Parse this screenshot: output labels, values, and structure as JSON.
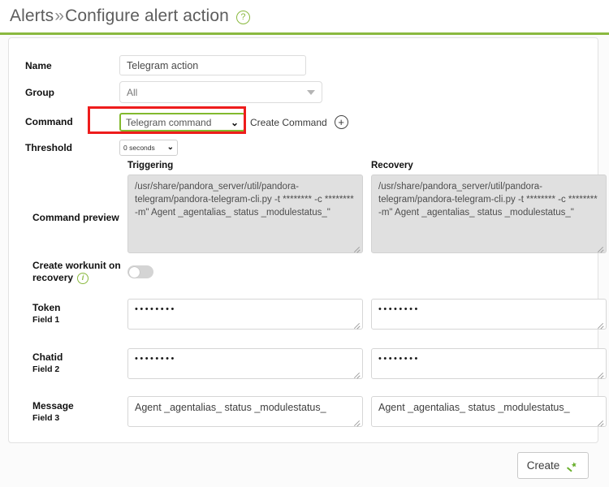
{
  "header": {
    "breadcrumb_root": "Alerts",
    "separator": "»",
    "breadcrumb_current": "Configure alert action",
    "help_icon_glyph": "?",
    "accent_color": "#8ab93f"
  },
  "form": {
    "name": {
      "label": "Name",
      "value": "Telegram action"
    },
    "group": {
      "label": "Group",
      "value": "All"
    },
    "command": {
      "label": "Command",
      "value": "Telegram command",
      "chevron": "⌄",
      "create_command_label": "Create Command",
      "plus_glyph": "+",
      "highlight_color": "#ee1c1c",
      "select_border_color": "#82b92e"
    },
    "threshold": {
      "label": "Threshold",
      "value": "0 seconds",
      "chevron": "⌄"
    },
    "command_preview": {
      "label": "Command preview",
      "triggering_header": "Triggering",
      "recovery_header": "Recovery",
      "triggering_value": "/usr/share/pandora_server/util/pandora-telegram/pandora-telegram-cli.py -t ******** -c ******** -m\" Agent _agentalias_ status _modulestatus_\"",
      "recovery_value": "/usr/share/pandora_server/util/pandora-telegram/pandora-telegram-cli.py -t ******** -c ******** -m\" Agent _agentalias_ status _modulestatus_\""
    },
    "workunit": {
      "label_line1": "Create workunit on",
      "label_line2": "recovery",
      "info_glyph": "i",
      "toggle_state": "off"
    },
    "fields": [
      {
        "label": "Token",
        "sub_label": "Field 1",
        "triggering_value": "••••••••",
        "recovery_value": "••••••••",
        "masked": true
      },
      {
        "label": "Chatid",
        "sub_label": "Field 2",
        "triggering_value": "••••••••",
        "recovery_value": "••••••••",
        "masked": true
      },
      {
        "label": "Message",
        "sub_label": "Field 3",
        "triggering_value": "Agent _agentalias_ status _modulestatus_",
        "recovery_value": "Agent _agentalias_ status _modulestatus_",
        "masked": false
      }
    ]
  },
  "footer": {
    "create_button_label": "Create",
    "wand_icon_color": "#6ab02e"
  }
}
